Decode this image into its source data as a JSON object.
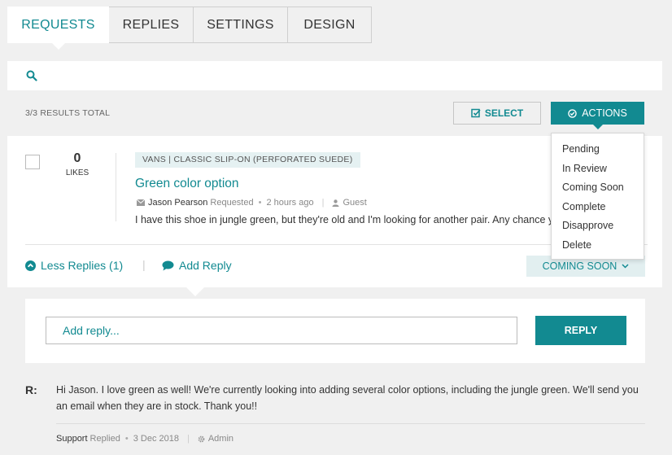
{
  "tabs": [
    {
      "label": "REQUESTS",
      "active": true
    },
    {
      "label": "REPLIES",
      "active": false
    },
    {
      "label": "SETTINGS",
      "active": false
    },
    {
      "label": "DESIGN",
      "active": false
    }
  ],
  "search": {
    "placeholder": ""
  },
  "results_total": "3/3 RESULTS TOTAL",
  "toolbar": {
    "select_label": "SELECT",
    "actions_label": "ACTIONS"
  },
  "actions_menu": [
    "Pending",
    "In Review",
    "Coming Soon",
    "Complete",
    "Disapprove",
    "Delete"
  ],
  "request": {
    "likes_count": "0",
    "likes_label": "LIKES",
    "tag": "VANS | CLASSIC SLIP-ON (PERFORATED SUEDE)",
    "title": "Green color option",
    "author": "Jason Pearson",
    "action": "Requested",
    "time": "2 hours ago",
    "role": "Guest",
    "body": "I have this shoe in jungle green, but they're old and I'm looking for another pair. Any chance you'll be getting them back?",
    "less_replies": "Less Replies (1)",
    "add_reply": "Add Reply",
    "status": "COMING SOON"
  },
  "reply_form": {
    "placeholder": "Add reply...",
    "button": "REPLY"
  },
  "reply": {
    "label": "R:",
    "text": "Hi Jason. I love green as well! We're currently looking into adding several color options, including the jungle green. We'll send you an email when they are in stock. Thank you!!",
    "author": "Support",
    "action": "Replied",
    "date": "3 Dec 2018",
    "role": "Admin"
  },
  "colors": {
    "accent": "#128a91",
    "background": "#f0f0f0",
    "tag_bg": "#e5f1f2"
  }
}
